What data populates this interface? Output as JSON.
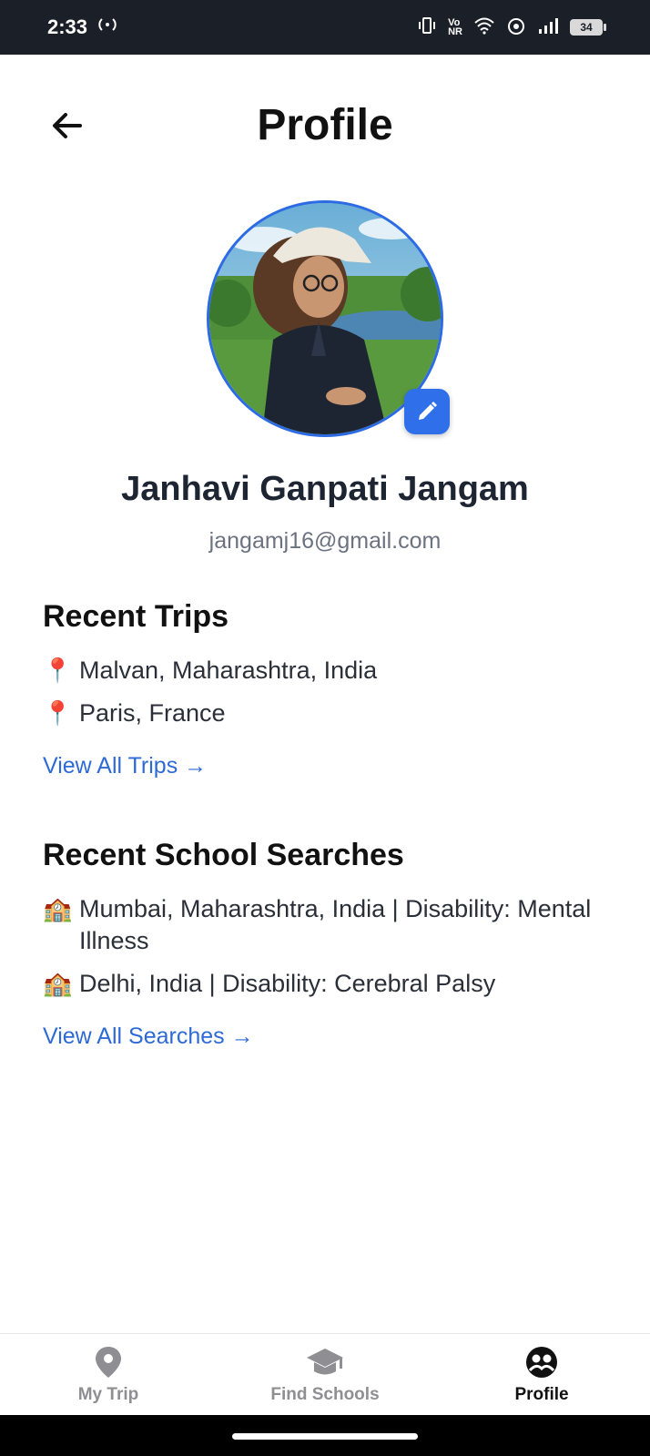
{
  "status_bar": {
    "time": "2:33",
    "battery": "34",
    "icons": [
      "hotspot-icon",
      "vibrate-icon",
      "volte-icon",
      "wifi-icon",
      "nfc-icon",
      "signal-icon",
      "battery-icon"
    ]
  },
  "header": {
    "title": "Profile",
    "back_icon": "arrow-left-icon"
  },
  "profile": {
    "name": "Janhavi Ganpati Jangam",
    "email": "jangamj16@gmail.com",
    "avatar": "avatar-illustration",
    "edit_icon": "pencil-icon"
  },
  "recent_trips": {
    "title": "Recent Trips",
    "items": [
      {
        "icon": "📍",
        "text": "Malvan, Maharashtra, India"
      },
      {
        "icon": "📍",
        "text": "Paris, France"
      }
    ],
    "link": "View All Trips →"
  },
  "recent_searches": {
    "title": "Recent School Searches",
    "items": [
      {
        "icon": "🏫",
        "text": "Mumbai, Maharashtra, India | Disability: Mental Illness"
      },
      {
        "icon": "🏫",
        "text": "Delhi, India | Disability: Cerebral Palsy"
      }
    ],
    "link": "View All Searches →"
  },
  "tabs": [
    {
      "label": "My Trip",
      "icon": "map-pin-icon",
      "active": false
    },
    {
      "label": "Find Schools",
      "icon": "graduation-cap-icon",
      "active": false
    },
    {
      "label": "Profile",
      "icon": "profile-icon",
      "active": true
    }
  ],
  "colors": {
    "accent": "#2f6fe9",
    "link": "#2e6ad6",
    "status_bar": "#1b1f27",
    "inactive_tab": "#8e8e93"
  }
}
